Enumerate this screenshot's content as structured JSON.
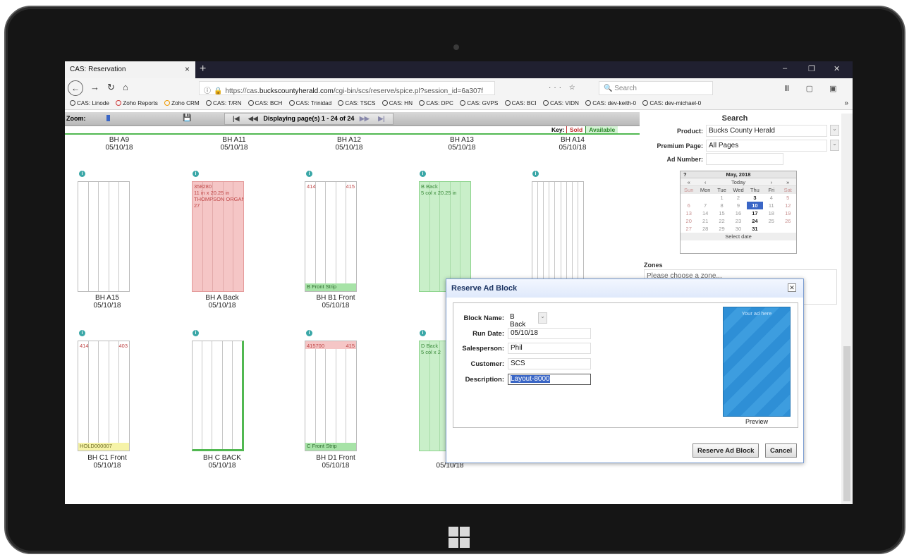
{
  "browser": {
    "tab_title": "CAS: Reservation",
    "tab_close": "×",
    "new_tab": "+",
    "win_min": "–",
    "win_restore": "❐",
    "win_close": "✕",
    "url_info": "ⓘ",
    "url_prefix": "https://cas.",
    "url_host": "buckscountyherald.com",
    "url_path": "/cgi-bin/scs/reserve/spice.pl?session_id=6a307f",
    "url_icons": "··· ☆",
    "search_placeholder": "Search",
    "right_icons": "Ⅲ ▢ ▣ ≡"
  },
  "bookmarks": [
    "CAS: Linode",
    "Zoho Reports",
    "Zoho CRM",
    "CAS: T/RN",
    "CAS: BCH",
    "CAS: Trinidad",
    "CAS: TSCS",
    "CAS: HN",
    "CAS: DPC",
    "CAS: GVPS",
    "CAS: BCI",
    "CAS: VIDN",
    "CAS: dev-keith-0",
    "CAS: dev-michael-0"
  ],
  "bookmarks_more": "»",
  "toolbar": {
    "zoom_label": "Zoom:",
    "pager_text": "Displaying page(s) 1 - 24 of 24",
    "first": "|◀",
    "prev": "◀◀",
    "next": "▶▶",
    "last": "▶|"
  },
  "key": {
    "label": "Key:",
    "sold": "Sold",
    "available": "Available"
  },
  "top_labels": [
    {
      "name": "BH A9",
      "date": "05/10/18"
    },
    {
      "name": "BH A11",
      "date": "05/10/18"
    },
    {
      "name": "BH A12",
      "date": "05/10/18"
    },
    {
      "name": "BH A13",
      "date": "05/10/18"
    },
    {
      "name": "BH A14",
      "date": "05/10/18"
    }
  ],
  "row1": [
    {
      "name": "BH A15",
      "date": "05/10/18",
      "text": "",
      "right": "",
      "strip": ""
    },
    {
      "name": "BH A Back",
      "date": "05/10/18",
      "text": "358280\n11 in x 20.25 in\nTHOMPSON ORGAN\n27",
      "right": "",
      "strip": ""
    },
    {
      "name": "BH B1 Front",
      "date": "05/10/18",
      "text": "414",
      "right": "415",
      "strip": "B Front Strip"
    },
    {
      "name": "",
      "date": "",
      "text": "B Back\n5 col x 20.25 in",
      "right": "",
      "strip": ""
    },
    {
      "name": "",
      "date": "",
      "text": "",
      "right": "",
      "strip": ""
    }
  ],
  "row2": [
    {
      "name": "BH C1 Front",
      "date": "05/10/18",
      "text": "414",
      "right": "403",
      "strip": "HOLD000007"
    },
    {
      "name": "BH C BACK",
      "date": "05/10/18",
      "text": "",
      "right": "",
      "strip": ""
    },
    {
      "name": "BH D1 Front",
      "date": "05/10/18",
      "text": "415700",
      "right": "415",
      "strip": "C Front Strip"
    },
    {
      "name": "",
      "date": "05/10/18",
      "text": "D Back\n5 col x 2",
      "right": "",
      "strip": ""
    }
  ],
  "search": {
    "title": "Search",
    "product_label": "Product:",
    "product_value": "Bucks County Herald",
    "premium_label": "Premium Page:",
    "premium_value": "All Pages",
    "adnum_label": "Ad Number:",
    "adnum_value": ""
  },
  "calendar": {
    "help": "?",
    "month": "May, 2018",
    "nav_prev_year": "«",
    "nav_prev": "‹",
    "today": "Today",
    "nav_next": "›",
    "nav_next_year": "»",
    "days": [
      "Sun",
      "Mon",
      "Tue",
      "Wed",
      "Thu",
      "Fri",
      "Sat"
    ],
    "weeks": [
      [
        "",
        "",
        "1",
        "2",
        "3",
        "4",
        "5"
      ],
      [
        "6",
        "7",
        "8",
        "9",
        "10",
        "11",
        "12"
      ],
      [
        "13",
        "14",
        "15",
        "16",
        "17",
        "18",
        "19"
      ],
      [
        "20",
        "21",
        "22",
        "23",
        "24",
        "25",
        "26"
      ],
      [
        "27",
        "28",
        "29",
        "30",
        "31",
        "",
        ""
      ]
    ],
    "selected": "10",
    "bold_days": [
      "3",
      "10",
      "17",
      "24",
      "31"
    ],
    "footer": "Select date"
  },
  "zones": {
    "label": "Zones",
    "placeholder": "Please choose a zone..."
  },
  "dialog": {
    "title": "Reserve Ad Block",
    "close": "✕",
    "block_name_label": "Block Name:",
    "block_name_value": "B Back",
    "run_date_label": "Run Date:",
    "run_date_value": "05/10/18",
    "salesperson_label": "Salesperson:",
    "salesperson_value": "Phil",
    "customer_label": "Customer:",
    "customer_value": "SCS",
    "description_label": "Description:",
    "description_value": "Layout-8000",
    "preview_text": "Your ad here",
    "preview_label": "Preview",
    "reserve_button": "Reserve Ad Block",
    "cancel_button": "Cancel",
    "hidden_label_date": "05/10/18"
  },
  "colors": {
    "sold": "#f5c6c6",
    "available": "#c9efc9",
    "accent": "#3a66c6"
  }
}
